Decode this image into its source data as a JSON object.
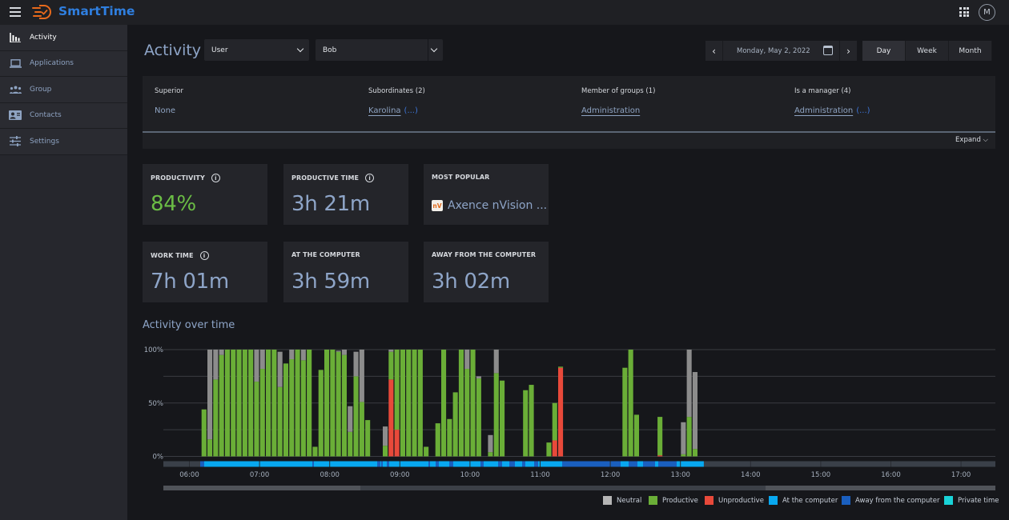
{
  "app": {
    "name": "SmartTime",
    "avatar_initial": "M"
  },
  "sidebar": {
    "items": [
      {
        "label": "Activity",
        "icon": "bar-chart-icon",
        "active": true
      },
      {
        "label": "Applications",
        "icon": "laptop-icon",
        "active": false
      },
      {
        "label": "Group",
        "icon": "group-icon",
        "active": false
      },
      {
        "label": "Contacts",
        "icon": "contact-card-icon",
        "active": false
      },
      {
        "label": "Settings",
        "icon": "sliders-icon",
        "active": false
      }
    ]
  },
  "header": {
    "title": "Activity",
    "type_select": "User",
    "user_select": "Bob",
    "date": "Monday, May 2, 2022",
    "ranges": [
      "Day",
      "Week",
      "Month"
    ],
    "active_range": "Day"
  },
  "info": {
    "columns": [
      {
        "label": "Superior",
        "value": "None",
        "link": false,
        "more": ""
      },
      {
        "label": "Subordinates (2)",
        "value": "Karolina",
        "link": true,
        "more": "(...)"
      },
      {
        "label": "Member of groups (1)",
        "value": "Administration",
        "link": true,
        "more": ""
      },
      {
        "label": "Is a manager (4)",
        "value": "Administration",
        "link": true,
        "more": "(...)"
      }
    ],
    "expand_label": "Expand"
  },
  "cards": [
    {
      "label": "PRODUCTIVITY",
      "value": "84%",
      "info": true
    },
    {
      "label": "PRODUCTIVE TIME",
      "value": "3h 21m",
      "info": true
    },
    {
      "label": "MOST POPULAR",
      "value": "Axence nVision ...",
      "app_icon": "nV"
    },
    {
      "label": "WORK TIME",
      "value": "7h 01m",
      "info": true
    },
    {
      "label": "AT THE COMPUTER",
      "value": "3h 59m",
      "info": false
    },
    {
      "label": "AWAY FROM THE COMPUTER",
      "value": "3h 02m",
      "info": false
    }
  ],
  "colors": {
    "neutral": "#8c8c8c",
    "productive": "#6aae37",
    "unproductive": "#e8493a",
    "at_computer": "#08a8f0",
    "away": "#1a5fbf",
    "private": "#19d3d8",
    "accent": "#2f7fe0"
  },
  "chart_data": {
    "type": "bar",
    "title": "Activity over time",
    "stacked": true,
    "interval_minutes": 5,
    "x_start": "06:00",
    "xticks": [
      "06:00",
      "07:00",
      "08:00",
      "09:00",
      "10:00",
      "11:00",
      "12:00",
      "13:00",
      "14:00",
      "15:00",
      "16:00",
      "17:00"
    ],
    "yticks": [
      "0%",
      "50%",
      "100%"
    ],
    "ylim": [
      0,
      100
    ],
    "legend": [
      "Neutral",
      "Productive",
      "Unproductive",
      "At the computer",
      "Away from the computer",
      "Private time"
    ],
    "legend_position": "bottom-right",
    "bars": [
      {
        "t": "06:10",
        "productive": 44,
        "unproductive": 0,
        "neutral": 0
      },
      {
        "t": "06:15",
        "productive": 16,
        "unproductive": 0,
        "neutral": 84
      },
      {
        "t": "06:20",
        "productive": 72,
        "unproductive": 0,
        "neutral": 28
      },
      {
        "t": "06:25",
        "productive": 95,
        "unproductive": 0,
        "neutral": 5
      },
      {
        "t": "06:30",
        "productive": 100,
        "unproductive": 0,
        "neutral": 0
      },
      {
        "t": "06:35",
        "productive": 100,
        "unproductive": 0,
        "neutral": 0
      },
      {
        "t": "06:40",
        "productive": 100,
        "unproductive": 0,
        "neutral": 0
      },
      {
        "t": "06:45",
        "productive": 100,
        "unproductive": 0,
        "neutral": 0
      },
      {
        "t": "06:50",
        "productive": 100,
        "unproductive": 0,
        "neutral": 0
      },
      {
        "t": "06:55",
        "productive": 70,
        "unproductive": 0,
        "neutral": 30
      },
      {
        "t": "07:00",
        "productive": 82,
        "unproductive": 0,
        "neutral": 18
      },
      {
        "t": "07:05",
        "productive": 100,
        "unproductive": 0,
        "neutral": 0
      },
      {
        "t": "07:10",
        "productive": 100,
        "unproductive": 0,
        "neutral": 0
      },
      {
        "t": "07:15",
        "productive": 65,
        "unproductive": 0,
        "neutral": 33
      },
      {
        "t": "07:20",
        "productive": 87,
        "unproductive": 0,
        "neutral": 0
      },
      {
        "t": "07:25",
        "productive": 91,
        "unproductive": 0,
        "neutral": 9
      },
      {
        "t": "07:30",
        "productive": 100,
        "unproductive": 0,
        "neutral": 0
      },
      {
        "t": "07:35",
        "productive": 90,
        "unproductive": 0,
        "neutral": 10
      },
      {
        "t": "07:40",
        "productive": 100,
        "unproductive": 0,
        "neutral": 0
      },
      {
        "t": "07:45",
        "productive": 9,
        "unproductive": 0,
        "neutral": 0
      },
      {
        "t": "07:50",
        "productive": 81,
        "unproductive": 0,
        "neutral": 0
      },
      {
        "t": "07:55",
        "productive": 100,
        "unproductive": 0,
        "neutral": 0
      },
      {
        "t": "08:00",
        "productive": 100,
        "unproductive": 0,
        "neutral": 0
      },
      {
        "t": "08:05",
        "productive": 98,
        "unproductive": 0,
        "neutral": 1
      },
      {
        "t": "08:10",
        "productive": 95,
        "unproductive": 0,
        "neutral": 5
      },
      {
        "t": "08:15",
        "productive": 23,
        "unproductive": 0,
        "neutral": 24
      },
      {
        "t": "08:20",
        "productive": 75,
        "unproductive": 0,
        "neutral": 23
      },
      {
        "t": "08:25",
        "productive": 51,
        "unproductive": 0,
        "neutral": 49
      },
      {
        "t": "08:30",
        "productive": 34,
        "unproductive": 0,
        "neutral": 0
      },
      {
        "t": "08:45",
        "productive": 10,
        "unproductive": 0,
        "neutral": 18
      },
      {
        "t": "08:50",
        "productive": 26,
        "unproductive": 72,
        "neutral": 2
      },
      {
        "t": "08:55",
        "productive": 75,
        "unproductive": 25,
        "neutral": 0
      },
      {
        "t": "09:00",
        "productive": 100,
        "unproductive": 0,
        "neutral": 0
      },
      {
        "t": "09:05",
        "productive": 100,
        "unproductive": 0,
        "neutral": 0
      },
      {
        "t": "09:10",
        "productive": 100,
        "unproductive": 0,
        "neutral": 0
      },
      {
        "t": "09:15",
        "productive": 100,
        "unproductive": 0,
        "neutral": 0
      },
      {
        "t": "09:20",
        "productive": 9,
        "unproductive": 0,
        "neutral": 0
      },
      {
        "t": "09:30",
        "productive": 31,
        "unproductive": 0,
        "neutral": 0
      },
      {
        "t": "09:35",
        "productive": 100,
        "unproductive": 0,
        "neutral": 0
      },
      {
        "t": "09:40",
        "productive": 35,
        "unproductive": 0,
        "neutral": 0
      },
      {
        "t": "09:45",
        "productive": 60,
        "unproductive": 0,
        "neutral": 0
      },
      {
        "t": "09:50",
        "productive": 100,
        "unproductive": 0,
        "neutral": 0
      },
      {
        "t": "09:55",
        "productive": 82,
        "unproductive": 0,
        "neutral": 18
      },
      {
        "t": "10:00",
        "productive": 100,
        "unproductive": 0,
        "neutral": 0
      },
      {
        "t": "10:05",
        "productive": 73,
        "unproductive": 0,
        "neutral": 2
      },
      {
        "t": "10:15",
        "productive": 4,
        "unproductive": 0,
        "neutral": 16
      },
      {
        "t": "10:20",
        "productive": 78,
        "unproductive": 0,
        "neutral": 22
      },
      {
        "t": "10:25",
        "productive": 71,
        "unproductive": 0,
        "neutral": 0
      },
      {
        "t": "10:45",
        "productive": 62,
        "unproductive": 0,
        "neutral": 0
      },
      {
        "t": "10:50",
        "productive": 67,
        "unproductive": 0,
        "neutral": 0
      },
      {
        "t": "11:05",
        "productive": 13,
        "unproductive": 0,
        "neutral": 0
      },
      {
        "t": "11:10",
        "productive": 35,
        "unproductive": 15,
        "neutral": 0
      },
      {
        "t": "11:15",
        "productive": 1,
        "unproductive": 83,
        "neutral": 0
      },
      {
        "t": "12:10",
        "productive": 83,
        "unproductive": 0,
        "neutral": 0
      },
      {
        "t": "12:15",
        "productive": 100,
        "unproductive": 0,
        "neutral": 0
      },
      {
        "t": "12:20",
        "productive": 39,
        "unproductive": 0,
        "neutral": 0
      },
      {
        "t": "12:40",
        "productive": 36,
        "unproductive": 1,
        "neutral": 0
      },
      {
        "t": "13:00",
        "productive": 2,
        "unproductive": 0,
        "neutral": 30
      },
      {
        "t": "13:05",
        "productive": 37,
        "unproductive": 0,
        "neutral": 63
      },
      {
        "t": "13:10",
        "productive": 7,
        "unproductive": 0,
        "neutral": 72
      }
    ],
    "presence_range": [
      "06:10",
      "13:20"
    ]
  }
}
